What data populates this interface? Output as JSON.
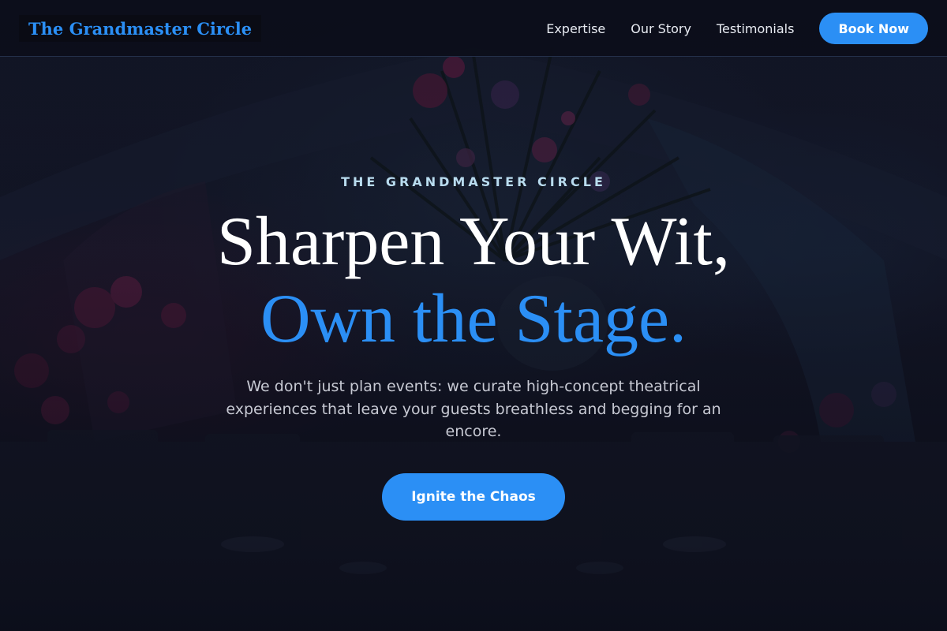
{
  "header": {
    "logo_text": "The Grandmaster Circle",
    "nav": [
      {
        "label": "Expertise"
      },
      {
        "label": "Our Story"
      },
      {
        "label": "Testimonials"
      }
    ],
    "book_label": "Book Now"
  },
  "hero": {
    "eyebrow": "THE GRANDMASTER CIRCLE",
    "headline_line1": "Sharpen Your Wit,",
    "headline_line2": "Own the Stage.",
    "subtext": "We don't just plan events: we curate high-concept theatrical experiences that leave your guests breathless and begging for an encore.",
    "cta_label": "Ignite the Chaos"
  },
  "colors": {
    "accent": "#2b8ff5",
    "background": "#0e1020",
    "eyebrow": "#b9dcef",
    "body_text": "#c7c9d3"
  }
}
